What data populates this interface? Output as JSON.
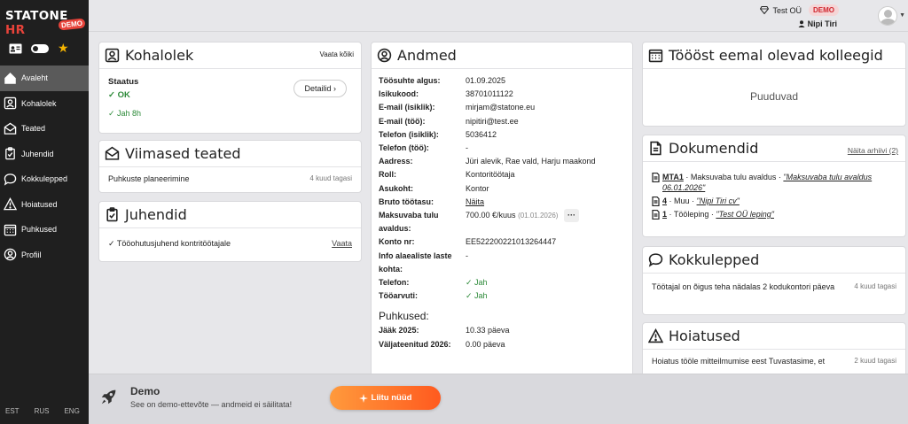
{
  "sidebar": {
    "logo_main": "STATONE",
    "logo_accent": "HR",
    "logo_badge": "DEMO",
    "items": [
      {
        "label": "Avaleht"
      },
      {
        "label": "Kohalolek"
      },
      {
        "label": "Teated"
      },
      {
        "label": "Juhendid"
      },
      {
        "label": "Kokkulepped"
      },
      {
        "label": "Hoiatused"
      },
      {
        "label": "Puhkused"
      },
      {
        "label": "Profiil"
      }
    ],
    "languages": [
      "EST",
      "RUS",
      "ENG"
    ]
  },
  "topbar": {
    "company": "Test OÜ",
    "company_badge": "DEMO",
    "user": "Nipi Tiri"
  },
  "kohalolek": {
    "title": "Kohalolek",
    "view_all": "Vaata kõiki",
    "status_label": "Staatus",
    "status_value": "✓ OK",
    "hours": "✓ Jah 8h",
    "details_button": "Detailid ›"
  },
  "teated": {
    "title": "Viimased teated",
    "item": "Puhkuste planeerimine",
    "time": "4 kuud tagasi"
  },
  "juhendid": {
    "title": "Juhendid",
    "item": "✓ Tööohutusjuhend kontritöötajale",
    "link": "Vaata"
  },
  "andmed": {
    "title": "Andmed",
    "rows": [
      {
        "key": "Töösuhte algus:",
        "value": "01.09.2025"
      },
      {
        "key": "Isikukood:",
        "value": "38701011122"
      },
      {
        "key": "E-mail (isiklik):",
        "value": "mirjam@statone.eu"
      },
      {
        "key": "E-mail (töö):",
        "value": "nipitiri@test.ee"
      },
      {
        "key": "Telefon (isiklik):",
        "value": "5036412"
      },
      {
        "key": "Telefon (töö):",
        "value": "-"
      },
      {
        "key": "Aadress:",
        "value": "Jüri alevik, Rae vald, Harju maakond"
      },
      {
        "key": "Roll:",
        "value": "Kontoritöötaja"
      },
      {
        "key": "Asukoht:",
        "value": "Kontor"
      },
      {
        "key": "Bruto töötasu:",
        "value": "Näita"
      }
    ],
    "salary_key": "Maksuvaba tulu avaldus:",
    "salary_value": "700.00 €/kuus",
    "salary_date": "(01.01.2026)",
    "salary_more": "···",
    "rows2": [
      {
        "key": "Konto nr:",
        "value": "EE522200221013264447"
      },
      {
        "key": "Info alaealiste laste kohta:",
        "value": "-"
      },
      {
        "key": "Telefon:",
        "value": "✓ Jah"
      },
      {
        "key": "Tööarvuti:",
        "value": "✓ Jah"
      }
    ],
    "vacation_title": "Puhkused:",
    "vacation_rows": [
      {
        "key": "Jääk 2025:",
        "value": "10.33 päeva"
      },
      {
        "key": "Väljateenitud 2026:",
        "value": "0.00 päeva"
      }
    ]
  },
  "kolleegid": {
    "title": "Töööst eemal olevad kolleegid",
    "empty": "Puuduvad"
  },
  "dokumendid": {
    "title": "Dokumendid",
    "archive_link": "Näita arhiivi (2)",
    "items": [
      {
        "code": "MTA1",
        "type": " · Maksuvaba tulu avaldus · ",
        "title": "\"Maksuvaba tulu avaldus 06.01.2026\""
      },
      {
        "code": "4",
        "type": " · Muu · ",
        "title": "\"Nipi Tiri cv\""
      },
      {
        "code": "1",
        "type": " · Tööleping · ",
        "title": "\"Test OÜ leping\""
      }
    ]
  },
  "kokkulepped": {
    "title": "Kokkulepped",
    "item": "Töötajal on õigus teha nädalas 2 kodukontori päeva",
    "time": "4 kuud tagasi"
  },
  "hoiatused": {
    "title": "Hoiatused",
    "item": "Hoiatus tööle mitteilmumise eest Tuvastasime, et",
    "time": "2 kuud tagasi"
  },
  "banner": {
    "title": "Demo",
    "text": "See on demo-ettevõte — andmeid ei säilitata!",
    "button": "Liitu nüüd"
  }
}
